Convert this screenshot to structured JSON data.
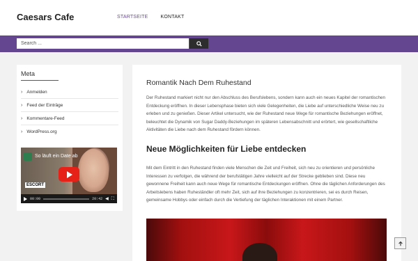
{
  "site": {
    "title": "Caesars Cafe"
  },
  "nav": {
    "items": [
      {
        "label": "STARTSEITE",
        "active": true
      },
      {
        "label": "KONTAKT",
        "active": false
      }
    ]
  },
  "search": {
    "placeholder": "Search ..."
  },
  "sidebar": {
    "widget_title": "Meta",
    "items": [
      {
        "label": "Anmelden"
      },
      {
        "label": "Feed der Einträge"
      },
      {
        "label": "Kommentare-Feed"
      },
      {
        "label": "WordPress.org"
      }
    ]
  },
  "video": {
    "title": "So läuft ein Date ab",
    "badge": "ESCORT",
    "time_current": "00:00",
    "time_total": "20:42"
  },
  "post": {
    "title": "Romantik Nach Dem Ruhestand",
    "intro": "Der Ruhestand markiert nicht nur den Abschluss des Berufslebens, sondern kann auch ein neues Kapitel der romantischen Entdeckung eröffnen. In dieser Lebensphase bieten sich viele Gelegenheiten, die Liebe auf unterschiedliche Weise neu zu erleben und zu genießen. Dieser Artikel untersucht, wie der Ruhestand neue Wege für romantische Beziehungen eröffnet, beleuchtet die Dynamik von Sugar Daddy-Beziehungen im späteren Lebensabschnitt und erörtert, wie gesellschaftliche Aktivitäten die Liebe nach dem Ruhestand fördern können.",
    "subheading": "Neue Möglichkeiten für Liebe entdecken",
    "paragraph2": "Mit dem Eintritt in den Ruhestand finden viele Menschen die Zeit und Freiheit, sich neu zu orientieren und persönliche Interessen zu verfolgen, die während der berufstätigen Jahre vielleicht auf der Strecke geblieben sind. Diese neu gewonnene Freiheit kann auch neue Wege für romantische Entdeckungen eröffnen. Ohne die täglichen Anforderungen des Arbeitslebens haben Ruheständler oft mehr Zeit, sich auf ihre Beziehungen zu konzentrieren, sei es durch Reisen, gemeinsame Hobbys oder einfach durch die Vertiefung der täglichen Interaktionen mit einem Partner."
  },
  "colors": {
    "accent": "#63468f",
    "dark": "#2d2d2d"
  },
  "icons": {
    "search": "search-icon",
    "scroll_top": "arrow-up-icon",
    "list_bullet": "chevron-right-icon"
  }
}
